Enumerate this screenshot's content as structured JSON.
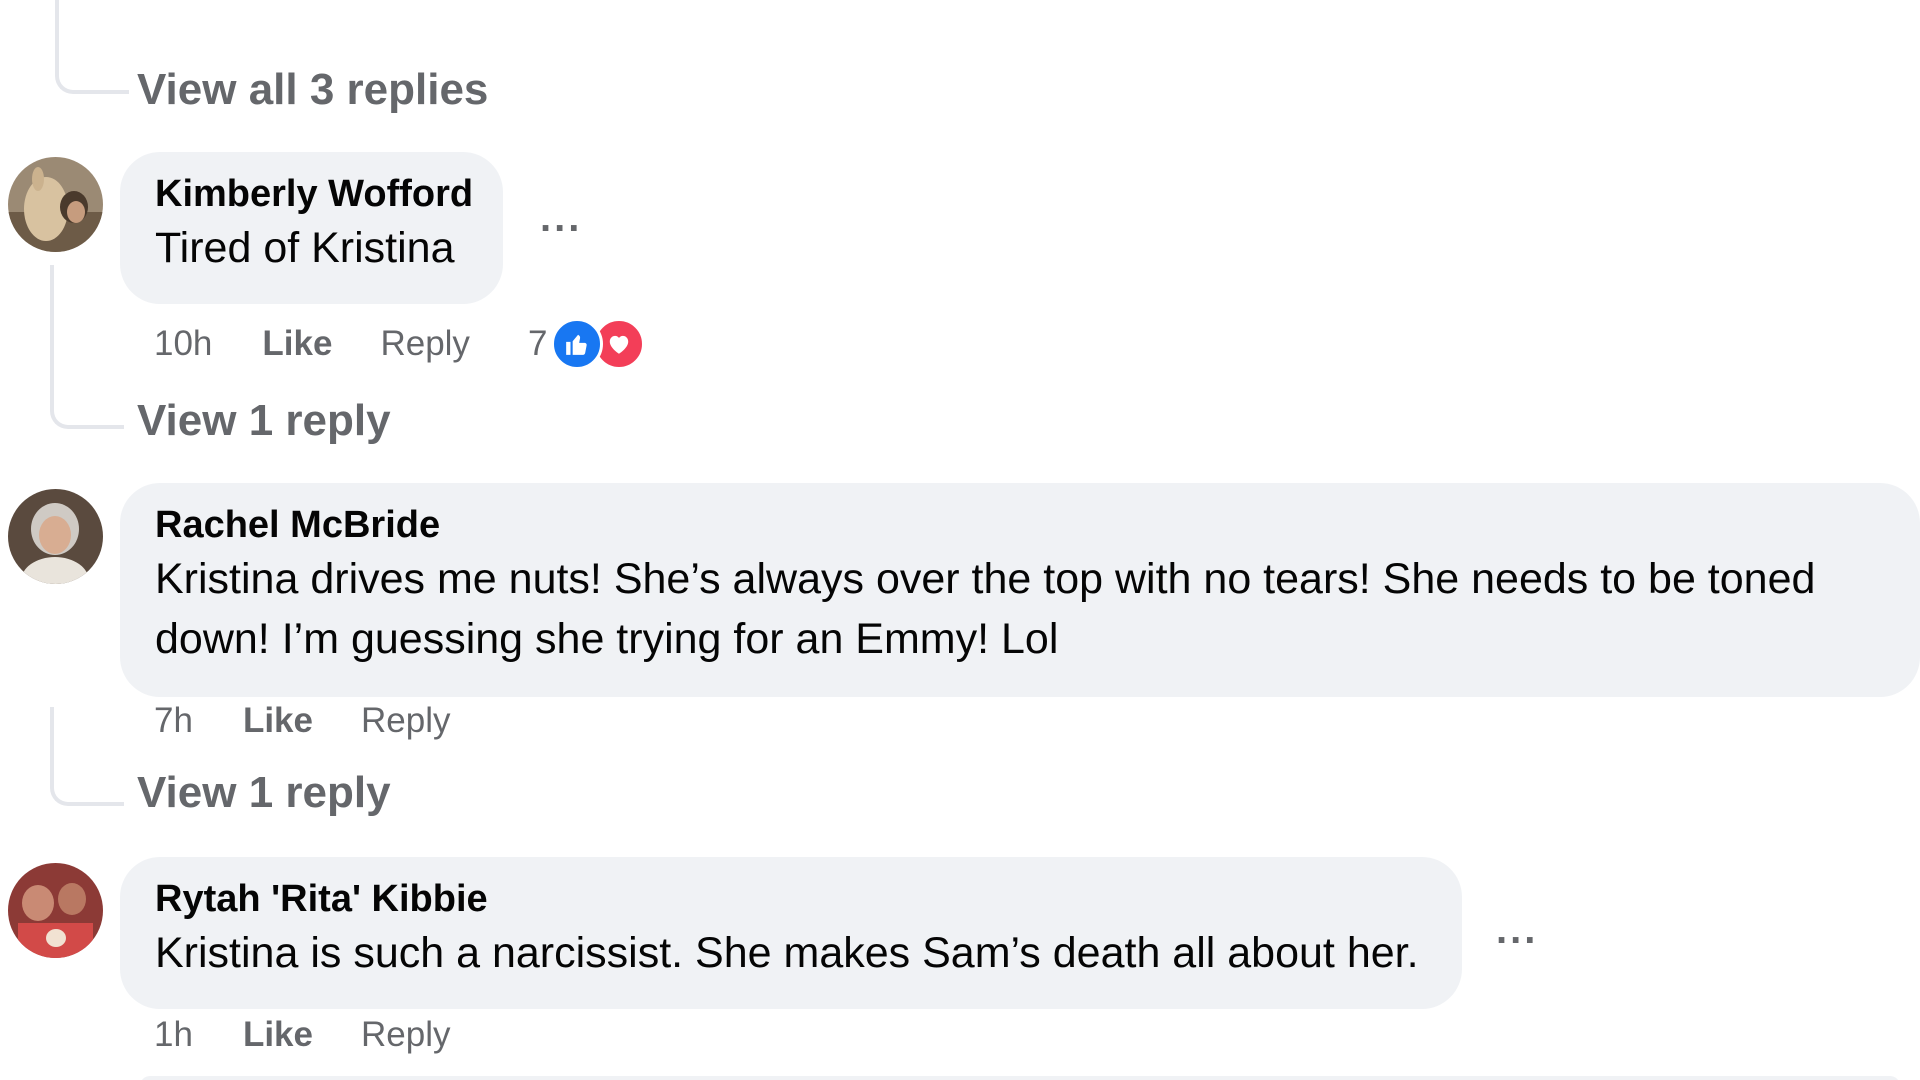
{
  "thread": {
    "top_view_replies": "View all 3 replies"
  },
  "comments": [
    {
      "author": "Kimberly Wofford",
      "text": "Tired of Kristina",
      "time": "10h",
      "like_label": "Like",
      "reply_label": "Reply",
      "reaction_count": "7",
      "reactions": [
        "like-icon",
        "love-icon"
      ],
      "view_replies": "View 1 reply",
      "more": "..."
    },
    {
      "author": "Rachel McBride",
      "text": "Kristina drives me nuts! She’s always over the top with no tears! She needs to be toned down! I’m guessing she trying for an Emmy! Lol",
      "time": "7h",
      "like_label": "Like",
      "reply_label": "Reply",
      "view_replies": "View 1 reply"
    },
    {
      "author": "Rytah 'Rita' Kibbie",
      "text": "Kristina is such a narcissist. She makes Sam’s death all about her.",
      "time": "1h",
      "like_label": "Like",
      "reply_label": "Reply",
      "more": "..."
    }
  ],
  "colors": {
    "bubble_bg": "#f0f2f5",
    "meta_text": "#65676b",
    "like_blue": "#1877f2",
    "love_red": "#f33e58"
  }
}
